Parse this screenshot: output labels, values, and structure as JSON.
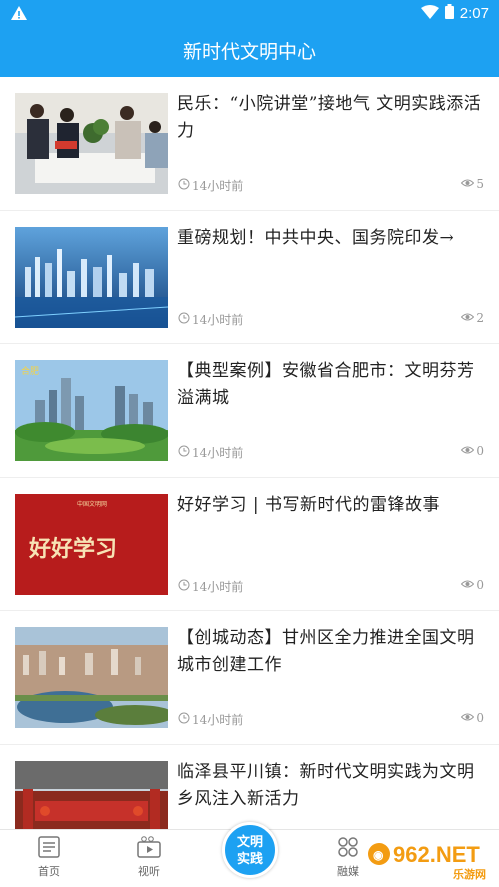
{
  "status": {
    "time": "2:07"
  },
  "header": {
    "title": "新时代文明中心"
  },
  "articles": [
    {
      "title": "民乐：“小院讲堂”接地气 文明实践添活力",
      "time": "14小时前",
      "views": "5"
    },
    {
      "title": "重磅规划！中共中央、国务院印发→",
      "time": "14小时前",
      "views": "2"
    },
    {
      "title": "【典型案例】安徽省合肥市：文明芬芳溢满城",
      "time": "14小时前",
      "views": "0"
    },
    {
      "title": "好好学习 | 书写新时代的雷锋故事",
      "time": "14小时前",
      "views": "0"
    },
    {
      "title": "【创城动态】甘州区全力推进全国文明城市创建工作",
      "time": "14小时前",
      "views": "0"
    },
    {
      "title": "临泽县平川镇：新时代文明实践为文明乡风注入新活力",
      "time": "",
      "views": ""
    }
  ],
  "thumb4": {
    "brand": "中国文明网",
    "text": "好好学习"
  },
  "nav": {
    "home": "首页",
    "video": "视听",
    "center_line1": "文明",
    "center_line2": "实践",
    "media": "融媒",
    "watermark": "962.NET",
    "watermark_sub": "乐游网"
  },
  "colors": {
    "primary": "#1da1f2",
    "text": "#222222",
    "meta": "#999999"
  }
}
